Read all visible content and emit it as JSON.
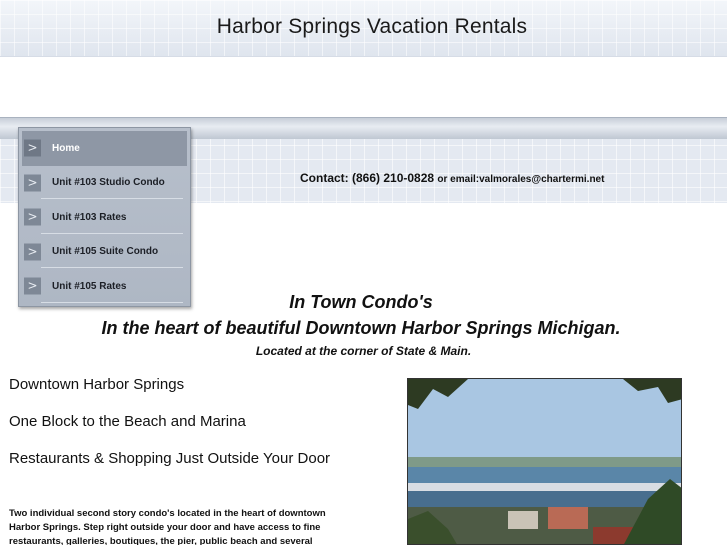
{
  "site": {
    "title": "Harbor Springs Vacation Rentals"
  },
  "nav": {
    "items": [
      {
        "label": "Home",
        "active": true
      },
      {
        "label": "Unit #103 Studio Condo",
        "active": false
      },
      {
        "label": "Unit #103 Rates",
        "active": false
      },
      {
        "label": "Unit #105 Suite Condo",
        "active": false
      },
      {
        "label": "Unit #105 Rates",
        "active": false
      }
    ]
  },
  "contact": {
    "label": "Contact: (866) 210-0828",
    "email_text": "or email:valmorales@chartermi.net"
  },
  "intro": {
    "title": "In Town Condo's",
    "subtitle": "In the heart of beautiful Downtown Harbor Springs Michigan.",
    "location": "Located at the corner of State & Main."
  },
  "features": [
    "Downtown Harbor Springs",
    "One Block to the Beach and Marina",
    "Restaurants & Shopping Just Outside Your Door"
  ],
  "description": "Two individual second story condo's located in the heart of downtown Harbor Springs. Step right outside your door and have access to fine restaurants, galleries, boutiques, the pier, public beach and several",
  "colors": {
    "menu_bg": "#b3bcc8",
    "menu_active": "#8e97a5",
    "band": "#e4e9f1"
  }
}
